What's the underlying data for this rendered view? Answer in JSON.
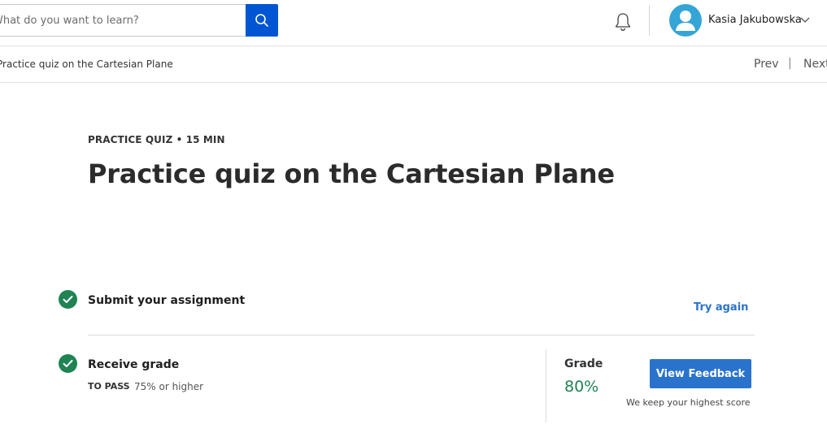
{
  "header": {
    "search": {
      "placeholder": "What do you want to learn?",
      "value": ""
    },
    "user": {
      "name": "Kasia Jakubowska"
    }
  },
  "subnav": {
    "breadcrumb": "Practice quiz on the Cartesian Plane",
    "prev_label": "Prev",
    "separator": "|",
    "next_label": "Next"
  },
  "quiz": {
    "eyebrow": "PRACTICE QUIZ • 15 MIN",
    "title": "Practice quiz on the Cartesian Plane"
  },
  "steps": {
    "submit": {
      "title": "Submit your assignment",
      "action_label": "Try again"
    },
    "grade": {
      "title": "Receive grade",
      "pass_label": "TO PASS",
      "pass_value": "75% or higher",
      "grade_label": "Grade",
      "grade_value": "80%",
      "feedback_button": "View Feedback",
      "note": "We keep your highest score"
    }
  },
  "colors": {
    "primary": "#0056d2",
    "link": "#2a73cc",
    "success": "#1f8354",
    "avatar": "#35a5d6"
  },
  "icons": [
    "search-icon",
    "bell-icon",
    "user-avatar-icon",
    "chevron-down-icon",
    "check-icon"
  ]
}
